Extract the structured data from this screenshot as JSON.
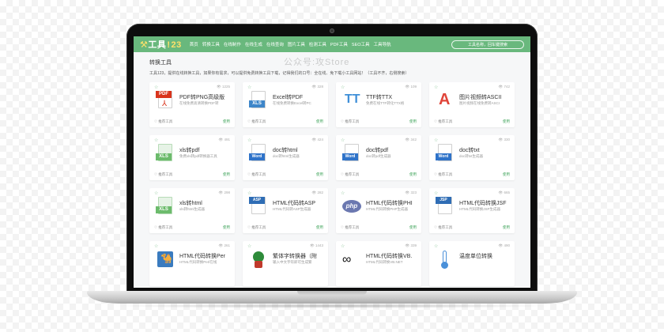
{
  "header": {
    "logo_main": "工具",
    "logo_bang": "!",
    "logo_num": "23",
    "nav": [
      "首页",
      "转换工具",
      "在线制作",
      "在线生成",
      "在线查询",
      "图片工具",
      "检测工具",
      "PDF工具",
      "SEO工具",
      "工具导航"
    ],
    "search_placeholder": "工具名称，回车键搜索"
  },
  "watermark": "公众号:攻Store",
  "section": {
    "title": "转换工具",
    "desc": "工具123，提供在线转换工具，如果你有需求，可以提供免费转换工具下载，记得我们的口号：全在线、免下载小工具网站！（工具不齐，右侧搜索）"
  },
  "card_labels": {
    "recommend": "推荐工具",
    "use": "使用"
  },
  "cards": [
    {
      "title": "PDF转PNG高级版",
      "desc": "在线免费高清转换PDF转",
      "views": "1225",
      "icon": "pdf-icon"
    },
    {
      "title": "Excel转PDF",
      "desc": "在线免费转换Excel转PC",
      "views": "328",
      "icon": "xls-icon"
    },
    {
      "title": "TTF转TTX",
      "desc": "免费在线TTF转化TTX格",
      "views": "109",
      "icon": "tt-icon"
    },
    {
      "title": "图片视频转ASCII",
      "desc": "图片视频在线免费转ASCI",
      "views": "742",
      "icon": "ascii-icon"
    },
    {
      "title": "xls转pdf",
      "desc": "免费xls转pdf转换器工具",
      "views": "491",
      "icon": "xls-green-icon"
    },
    {
      "title": "doc转html",
      "desc": "doc转html生成器",
      "views": "424",
      "icon": "word-icon"
    },
    {
      "title": "doc转pdf",
      "desc": "doc转pdf生成器",
      "views": "342",
      "icon": "word-icon"
    },
    {
      "title": "doc转txt",
      "desc": "doc转txt生成器",
      "views": "330",
      "icon": "word-icon"
    },
    {
      "title": "xls转html",
      "desc": "xls转html生成器",
      "views": "298",
      "icon": "xls-green-icon"
    },
    {
      "title": "HTML代码转ASP",
      "desc": "HTML代码转ASP生成器",
      "views": "282",
      "icon": "asp-icon"
    },
    {
      "title": "HTML代码转换PHI",
      "desc": "HTML代码转换PHP生成器",
      "views": "323",
      "icon": "php-icon"
    },
    {
      "title": "HTML代码转换JSF",
      "desc": "HTML代码转换JSP生成器",
      "views": "665",
      "icon": "jsp-icon"
    },
    {
      "title": "HTML代码转换Per",
      "desc": "HTML代码转换Perl在线",
      "views": "261",
      "icon": "perl-icon"
    },
    {
      "title": "繁体字转换器（附",
      "desc": "输入中文字符即可生成繁",
      "views": "1443",
      "icon": "dragon-icon"
    },
    {
      "title": "HTML代码转换VB.",
      "desc": "HTML代码转换VB.NET",
      "views": "339",
      "icon": "vb-icon"
    },
    {
      "title": "温度单位转换",
      "desc": "",
      "views": "490",
      "icon": "thermometer-icon"
    }
  ],
  "colors": {
    "brand": "#69b87d",
    "accent": "#ffe16a",
    "use": "#3fa35a"
  }
}
